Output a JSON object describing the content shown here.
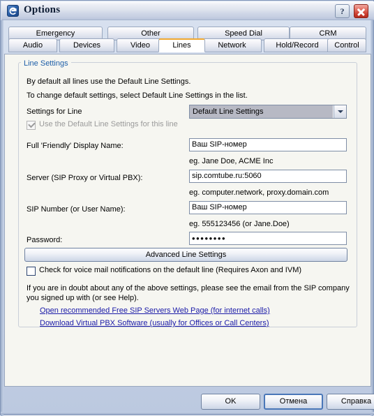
{
  "window": {
    "title": "Options",
    "icon": "app-logo-icon",
    "help_button": "?",
    "close_button": "close-icon"
  },
  "tabs": {
    "row_top": [
      {
        "label": "Emergency",
        "active": false
      },
      {
        "label": "Other",
        "active": false
      },
      {
        "label": "Speed Dial",
        "active": false
      },
      {
        "label": "CRM",
        "active": false
      }
    ],
    "row_bottom": [
      {
        "label": "Audio",
        "active": false
      },
      {
        "label": "Devices",
        "active": false
      },
      {
        "label": "Video",
        "active": false
      },
      {
        "label": "Lines",
        "active": true
      },
      {
        "label": "Network",
        "active": false
      },
      {
        "label": "Hold/Record",
        "active": false
      },
      {
        "label": "Control",
        "active": false
      }
    ],
    "active_tab": "Lines",
    "accent_color": "#f0a830"
  },
  "line_settings": {
    "group_title": "Line Settings",
    "intro_line1": "By default all lines use the Default Line Settings.",
    "intro_line2": "To change default settings, select Default Line Settings in the list.",
    "settings_for_line_label": "Settings for Line",
    "settings_for_line_value": "Default Line Settings",
    "use_default_checkbox_label": "Use the Default Line Settings for this line",
    "use_default_checkbox_checked": true,
    "use_default_checkbox_disabled": true,
    "display_name_label": "Full 'Friendly' Display Name:",
    "display_name_value": "Ваш SIP-номер",
    "display_name_hint": "eg. Jane Doe, ACME Inc",
    "server_label": "Server (SIP Proxy or Virtual PBX):",
    "server_value": "sip.comtube.ru:5060",
    "server_hint": "eg. computer.network, proxy.domain.com",
    "sip_number_label": "SIP Number (or User Name):",
    "sip_number_value": "Ваш SIP-номер",
    "sip_number_hint": "eg. 555123456 (or Jane.Doe)",
    "password_label": "Password:",
    "password_value": "••••••••",
    "advanced_button": "Advanced Line Settings",
    "voicemail_checkbox_label": "Check for voice mail notifications on the default line (Requires Axon and IVM)",
    "voicemail_checkbox_checked": false,
    "doubt_line1": "If you are in doubt about any of the above settings, please see the email from the SIP company",
    "doubt_line2": "you signed up with (or see Help).",
    "link_sip_servers": "Open recommended Free SIP Servers Web Page (for internet calls)",
    "link_virtual_pbx": "Download Virtual PBX Software (usually for Offices or Call Centers)",
    "link_color": "#1a1aa8"
  },
  "footer": {
    "ok": "OK",
    "cancel": "Отмена",
    "help": "Справка",
    "default_button": "Отмена"
  }
}
